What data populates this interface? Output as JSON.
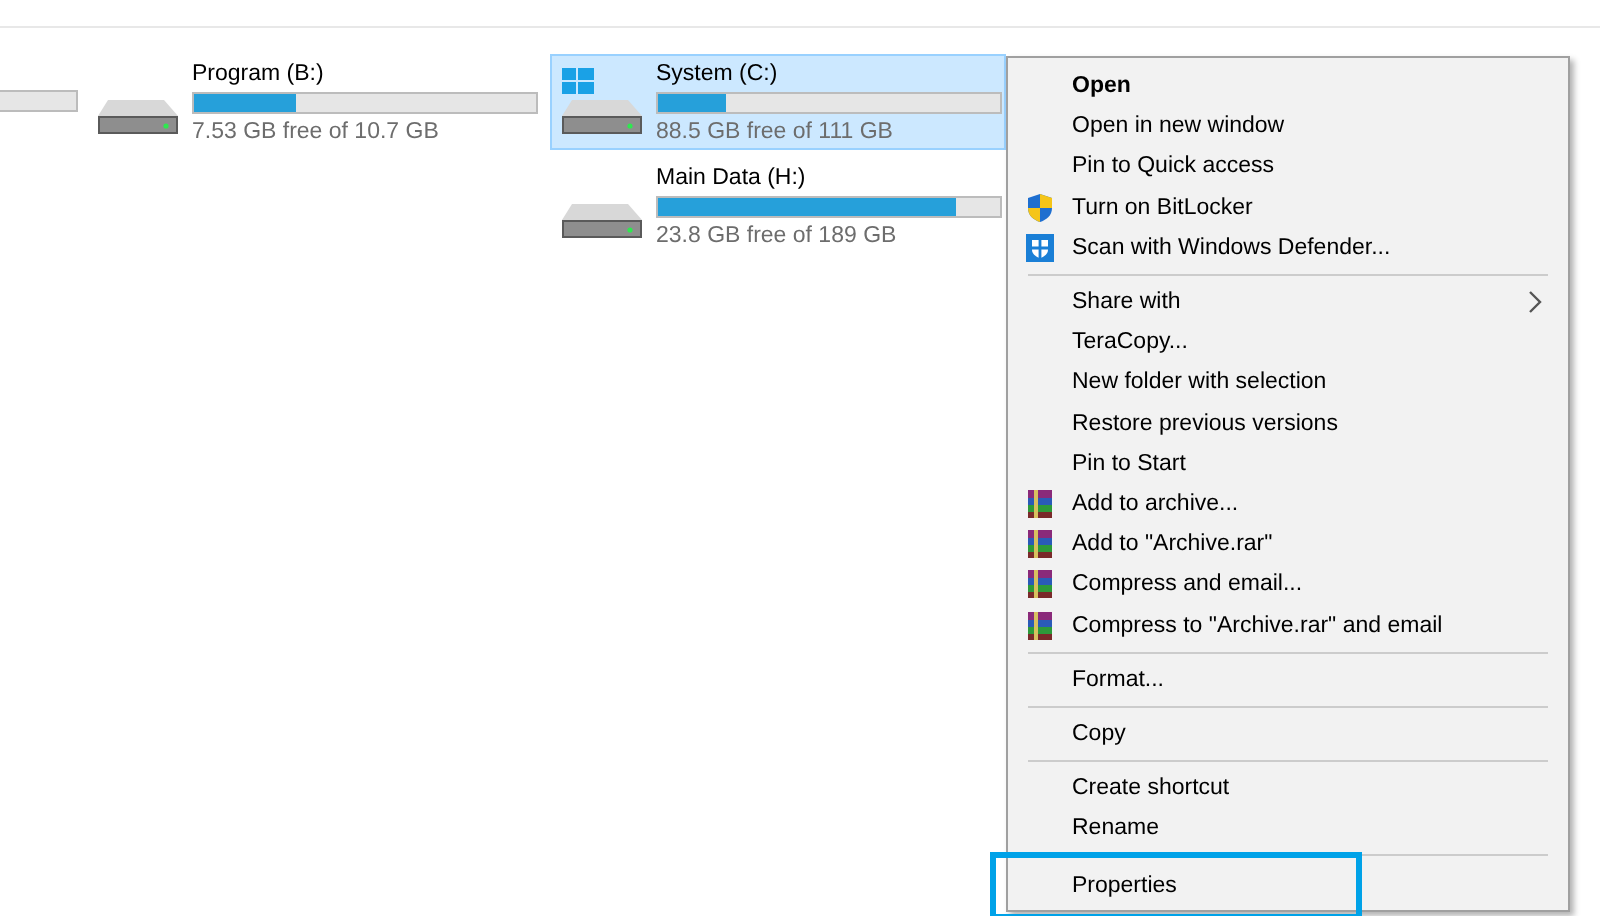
{
  "drives": [
    {
      "kind": "partial"
    },
    {
      "kind": "drive",
      "name": "Program (B:)",
      "free": "7.53 GB free of 10.7 GB",
      "level": 0.3,
      "selected": false
    },
    {
      "kind": "system",
      "name": "System (C:)",
      "free": "88.5 GB free of 111 GB",
      "level": 0.2,
      "selected": true
    },
    {
      "kind": "drive",
      "name": "Main Data (H:)",
      "free": "23.8 GB free of 189 GB",
      "level": 0.87,
      "selected": false
    }
  ],
  "context_menu": {
    "items": [
      {
        "kind": "item",
        "label": "Open",
        "default": true
      },
      {
        "kind": "item",
        "label": "Open in new window"
      },
      {
        "kind": "item",
        "label": "Pin to Quick access"
      },
      {
        "kind": "shield",
        "label": "Turn on BitLocker"
      },
      {
        "kind": "defender",
        "label": "Scan with Windows Defender..."
      },
      {
        "kind": "separator"
      },
      {
        "kind": "item",
        "label": "Share with",
        "submenu": true
      },
      {
        "kind": "item",
        "label": "TeraCopy..."
      },
      {
        "kind": "item",
        "label": "New folder with selection"
      },
      {
        "kind": "item",
        "label": "Restore previous versions"
      },
      {
        "kind": "item",
        "label": "Pin to Start"
      },
      {
        "kind": "archive",
        "label": "Add to archive..."
      },
      {
        "kind": "archive",
        "label": "Add to \"Archive.rar\""
      },
      {
        "kind": "archive",
        "label": "Compress and email..."
      },
      {
        "kind": "archive",
        "label": "Compress to \"Archive.rar\" and email"
      },
      {
        "kind": "separator"
      },
      {
        "kind": "item",
        "label": "Format..."
      },
      {
        "kind": "separator"
      },
      {
        "kind": "item",
        "label": "Copy"
      },
      {
        "kind": "separator"
      },
      {
        "kind": "item",
        "label": "Create shortcut"
      },
      {
        "kind": "item",
        "label": "Rename"
      },
      {
        "kind": "separator"
      },
      {
        "kind": "item",
        "label": "Properties",
        "highlighted": true
      }
    ]
  }
}
